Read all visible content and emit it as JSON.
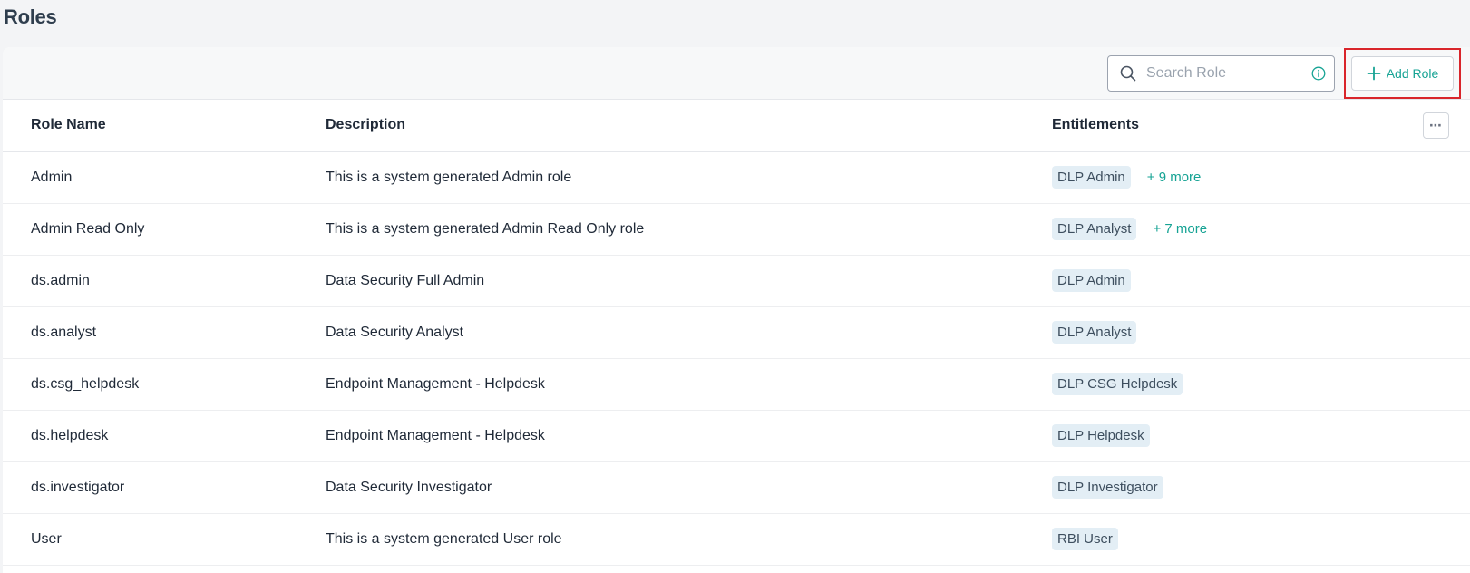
{
  "page": {
    "title": "Roles"
  },
  "toolbar": {
    "search_placeholder": "Search Role",
    "add_role_label": "Add Role",
    "accent_color": "#16a394",
    "highlight_color": "#d9252b"
  },
  "table": {
    "columns": {
      "name": "Role Name",
      "description": "Description",
      "entitlements": "Entitlements"
    },
    "rows": [
      {
        "name": "Admin",
        "description": "This is a system generated Admin role",
        "entitlement": "DLP Admin",
        "more": "+ 9 more"
      },
      {
        "name": "Admin Read Only",
        "description": "This is a system generated Admin Read Only role",
        "entitlement": "DLP Analyst",
        "more": "+ 7 more"
      },
      {
        "name": "ds.admin",
        "description": "Data Security Full Admin",
        "entitlement": "DLP Admin",
        "more": ""
      },
      {
        "name": "ds.analyst",
        "description": "Data Security Analyst",
        "entitlement": "DLP Analyst",
        "more": ""
      },
      {
        "name": "ds.csg_helpdesk",
        "description": "Endpoint Management - Helpdesk",
        "entitlement": "DLP CSG Helpdesk",
        "more": ""
      },
      {
        "name": "ds.helpdesk",
        "description": "Endpoint Management - Helpdesk",
        "entitlement": "DLP Helpdesk",
        "more": ""
      },
      {
        "name": "ds.investigator",
        "description": "Data Security Investigator",
        "entitlement": "DLP Investigator",
        "more": ""
      },
      {
        "name": "User",
        "description": "This is a system generated User role",
        "entitlement": "RBI User",
        "more": ""
      }
    ]
  }
}
